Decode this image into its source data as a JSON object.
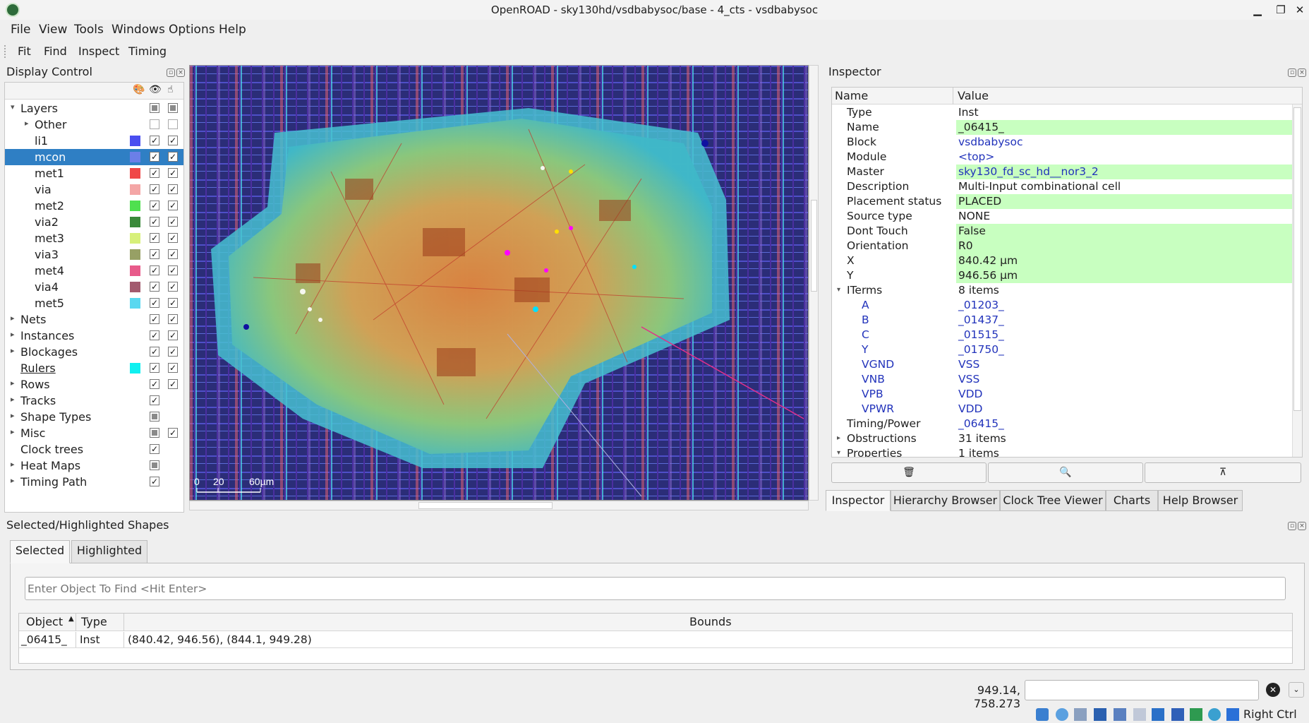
{
  "window": {
    "title": "OpenROAD - sky130hd/vsdbabysoc/base - 4_cts - vsdbabysoc"
  },
  "menubar": [
    "File",
    "View",
    "Tools",
    "Windows",
    "Options",
    "Help"
  ],
  "toolbar": [
    "Fit",
    "Find",
    "Inspect",
    "Timing"
  ],
  "display_control": {
    "title": "Display Control",
    "rows": [
      {
        "label": "Layers",
        "expander": "open",
        "visible": "partial",
        "selectable": "partial"
      },
      {
        "label": "Other",
        "expander": "closed",
        "visible": "unchecked",
        "selectable": "unchecked"
      },
      {
        "label": "li1",
        "color": "#4a4ef0",
        "visible": "checked",
        "selectable": "checked"
      },
      {
        "label": "mcon",
        "color": "#6b7fe8",
        "visible": "checked",
        "selectable": "checked",
        "selected": true
      },
      {
        "label": "met1",
        "color": "#f04848",
        "visible": "checked",
        "selectable": "checked"
      },
      {
        "label": "via",
        "color": "#f4a6a6",
        "visible": "checked",
        "selectable": "checked"
      },
      {
        "label": "met2",
        "color": "#4fe04f",
        "visible": "checked",
        "selectable": "checked"
      },
      {
        "label": "via2",
        "color": "#3a8a3a",
        "visible": "checked",
        "selectable": "checked"
      },
      {
        "label": "met3",
        "color": "#d7f07a",
        "visible": "checked",
        "selectable": "checked"
      },
      {
        "label": "via3",
        "color": "#97a065",
        "visible": "checked",
        "selectable": "checked"
      },
      {
        "label": "met4",
        "color": "#e85a8a",
        "visible": "checked",
        "selectable": "checked"
      },
      {
        "label": "via4",
        "color": "#a25a6e",
        "visible": "checked",
        "selectable": "checked"
      },
      {
        "label": "met5",
        "color": "#5ad8f0",
        "visible": "checked",
        "selectable": "checked"
      },
      {
        "label": "Nets",
        "expander": "closed",
        "visible": "checked",
        "selectable": "checked"
      },
      {
        "label": "Instances",
        "expander": "closed",
        "visible": "checked",
        "selectable": "checked"
      },
      {
        "label": "Blockages",
        "expander": "closed",
        "visible": "checked",
        "selectable": "checked"
      },
      {
        "label": "Rulers",
        "color": "#10f0f0",
        "visible": "checked",
        "selectable": "checked"
      },
      {
        "label": "Rows",
        "expander": "closed",
        "visible": "checked",
        "selectable": "checked"
      },
      {
        "label": "Tracks",
        "expander": "closed",
        "visible": "checked"
      },
      {
        "label": "Shape Types",
        "expander": "closed",
        "visible": "partial"
      },
      {
        "label": "Misc",
        "expander": "closed",
        "visible": "partial",
        "selectable": "checked"
      },
      {
        "label": "Clock trees",
        "visible": "checked"
      },
      {
        "label": "Heat Maps",
        "expander": "closed",
        "visible": "partial"
      },
      {
        "label": "Timing Path",
        "expander": "closed",
        "visible": "checked"
      }
    ]
  },
  "layout_view": {
    "scale_labels": [
      "0",
      "20",
      "60µm"
    ]
  },
  "inspector": {
    "title": "Inspector",
    "columns": [
      "Name",
      "Value"
    ],
    "rows": [
      {
        "name": "Type",
        "value": "Inst"
      },
      {
        "name": "Name",
        "value": "_06415_",
        "hl": true
      },
      {
        "name": "Block",
        "value": "vsdbabysoc",
        "link": true
      },
      {
        "name": "Module",
        "value": "<top>",
        "link": true
      },
      {
        "name": "Master",
        "value": "sky130_fd_sc_hd__nor3_2",
        "link": true,
        "hl": true
      },
      {
        "name": "Description",
        "value": "Multi-Input combinational cell"
      },
      {
        "name": "Placement status",
        "value": "PLACED",
        "hl": true
      },
      {
        "name": "Source type",
        "value": "NONE"
      },
      {
        "name": "Dont Touch",
        "value": "False",
        "hl": true
      },
      {
        "name": "Orientation",
        "value": "R0",
        "hl": true
      },
      {
        "name": "X",
        "value": "840.42 µm",
        "hl": true
      },
      {
        "name": "Y",
        "value": "946.56 µm",
        "hl": true
      },
      {
        "name": "ITerms",
        "value": "8 items",
        "expander": "open"
      },
      {
        "name": "A",
        "value": "_01203_",
        "child": true
      },
      {
        "name": "B",
        "value": "_01437_",
        "child": true
      },
      {
        "name": "C",
        "value": "_01515_",
        "child": true
      },
      {
        "name": "Y",
        "value": "_01750_",
        "child": true
      },
      {
        "name": "VGND",
        "value": "VSS",
        "child": true
      },
      {
        "name": "VNB",
        "value": "VSS",
        "child": true
      },
      {
        "name": "VPB",
        "value": "VDD",
        "child": true
      },
      {
        "name": "VPWR",
        "value": "VDD",
        "child": true
      },
      {
        "name": "Timing/Power",
        "value": "_06415_",
        "link": true
      },
      {
        "name": "Obstructions",
        "value": "31 items",
        "expander": "closed"
      },
      {
        "name": "Properties",
        "value": "1 items",
        "expander": "open"
      }
    ],
    "buttons": [
      "delete-icon",
      "zoom-icon",
      "clear-icon"
    ],
    "tabs": [
      "Inspector",
      "Hierarchy Browser",
      "Clock Tree Viewer",
      "Charts",
      "Help Browser"
    ]
  },
  "selected_shapes": {
    "title": "Selected/Highlighted Shapes",
    "tabs": [
      "Selected",
      "Highlighted"
    ],
    "search_placeholder": "Enter Object To Find <Hit Enter>",
    "columns": [
      "Object",
      "Type",
      "Bounds"
    ],
    "rows": [
      {
        "object": "_06415_",
        "type": "Inst",
        "bounds": "(840.42, 946.56), (844.1, 949.28)"
      }
    ]
  },
  "status": {
    "coords": "949.14, 758.273",
    "command": "",
    "tray_label": "Right Ctrl"
  },
  "colors": {
    "selection": "#2f7fc4",
    "highlight": "#c8ffc0",
    "link": "#2233bb"
  }
}
